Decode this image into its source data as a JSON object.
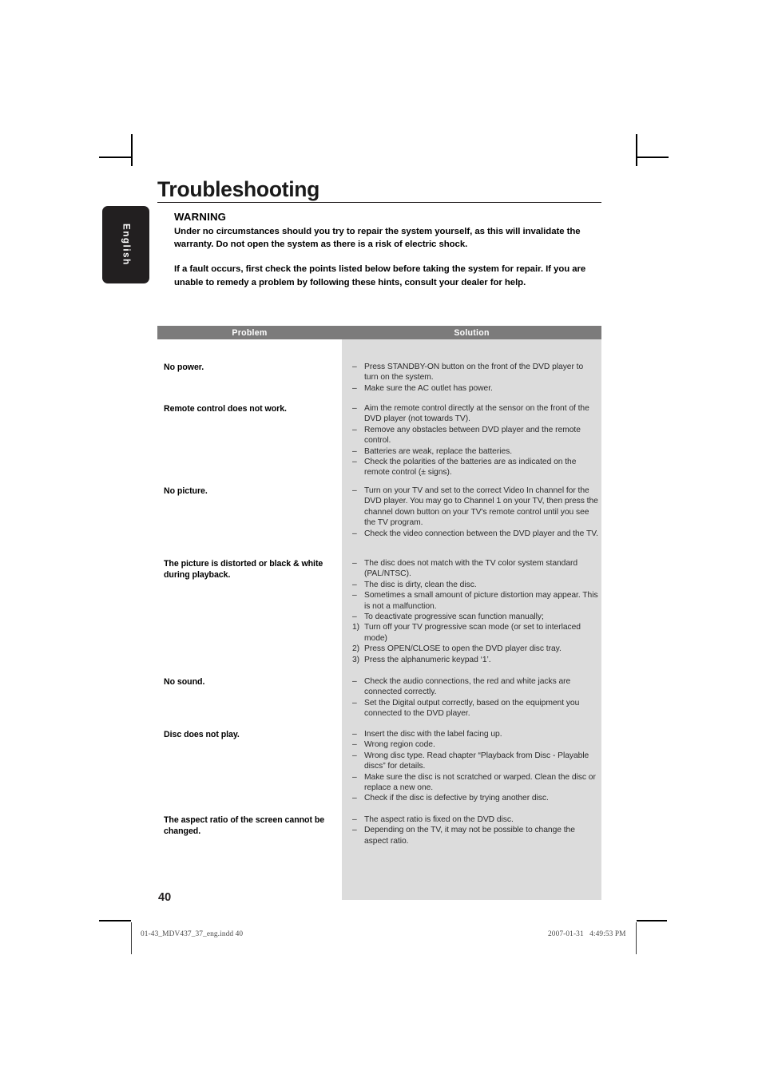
{
  "page": {
    "title": "Troubleshooting",
    "language_tab": "English",
    "page_number": "40"
  },
  "warning": {
    "heading": "WARNING",
    "paragraph1": "Under no circumstances should you try to repair the system yourself, as this will invalidate the warranty. Do not open the system as there is a risk of electric shock.",
    "paragraph2": "If a fault occurs, first check the points listed below before taking the system for repair. If you are unable to remedy a problem by following these hints, consult your dealer for help."
  },
  "table": {
    "columns": [
      "Problem",
      "Solution"
    ],
    "rows": [
      {
        "problem": "No power.",
        "solutions": [
          {
            "marker": "–",
            "text": "Press STANDBY-ON button on the front of the DVD player to turn on the system."
          },
          {
            "marker": "–",
            "text": "Make sure the AC outlet has power."
          }
        ]
      },
      {
        "problem": "Remote control does not work.",
        "solutions": [
          {
            "marker": "–",
            "text": "Aim the remote control directly at the sensor on the front of the DVD player (not towards TV)."
          },
          {
            "marker": "–",
            "text": "Remove any obstacles between DVD player and the remote control."
          },
          {
            "marker": "–",
            "text": "Batteries are weak, replace the batteries."
          },
          {
            "marker": "–",
            "text": "Check the polarities of the batteries are as indicated on the remote control (± signs)."
          }
        ]
      },
      {
        "problem": "No picture.",
        "solutions": [
          {
            "marker": "–",
            "text": "Turn on your TV and set to the correct Video In channel for the DVD player. You may go to Channel 1 on your TV, then press the channel down button on your TV's remote control until you see the TV program."
          },
          {
            "marker": "–",
            "text": "Check the video connection between the DVD player and the TV."
          }
        ]
      },
      {
        "problem": "The picture is distorted or black & white during playback.",
        "solutions": [
          {
            "marker": "–",
            "text": "The disc does not match with the TV color system standard (PAL/NTSC)."
          },
          {
            "marker": "–",
            "text": "The disc is dirty, clean the disc."
          },
          {
            "marker": "–",
            "text": "Sometimes a small amount of picture distortion may appear. This is not a malfunction."
          },
          {
            "marker": "–",
            "text": "To deactivate progressive scan function manually;"
          },
          {
            "marker": "1)",
            "text": "Turn off your TV progressive scan mode (or set to interlaced mode)"
          },
          {
            "marker": "2)",
            "text": "Press OPEN/CLOSE to open the DVD player disc tray."
          },
          {
            "marker": "3)",
            "text": "Press the alphanumeric keypad ‘1’."
          }
        ]
      },
      {
        "problem": "No sound.",
        "solutions": [
          {
            "marker": "–",
            "text": "Check the audio connections, the red and white jacks are connected correctly."
          },
          {
            "marker": "–",
            "text": "Set the Digital output correctly, based on the equipment you connected to the DVD player."
          }
        ]
      },
      {
        "problem": "Disc does not play.",
        "solutions": [
          {
            "marker": "–",
            "text": "Insert the disc with the label facing up."
          },
          {
            "marker": "–",
            "text": "Wrong region code."
          },
          {
            "marker": "–",
            "text": "Wrong disc type. Read chapter “Playback from Disc - Playable discs” for details."
          },
          {
            "marker": "–",
            "text": "Make sure the disc is not scratched or warped. Clean the disc or replace a new one."
          },
          {
            "marker": "–",
            "text": "Check if the disc is defective by trying another disc."
          }
        ]
      },
      {
        "problem": "The aspect ratio of the screen cannot be changed.",
        "solutions": [
          {
            "marker": "–",
            "text": "The aspect ratio is fixed on the DVD disc."
          },
          {
            "marker": "–",
            "text": "Depending on the TV, it may not be possible to change the aspect ratio."
          }
        ]
      }
    ]
  },
  "footer": {
    "file_name": "01-43_MDV437_37_eng.indd   40",
    "timestamp": "2007-01-31   4:49:53 PM"
  },
  "colors": {
    "header_gray": "#7c7b7b",
    "solution_gray": "#dcdcdc",
    "tab_black": "#221f20"
  }
}
